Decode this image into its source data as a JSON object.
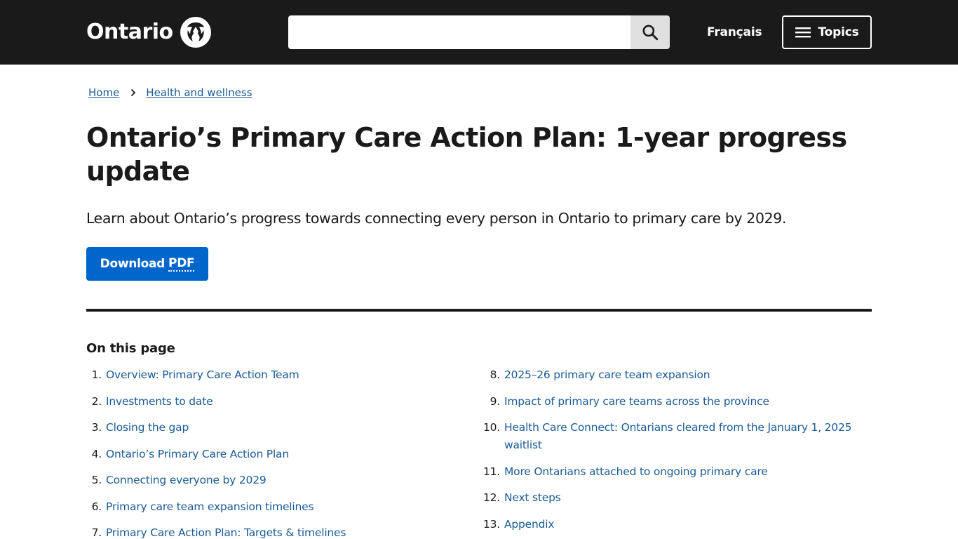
{
  "header": {
    "logo_text": "Ontario",
    "logo_icon": "ontario-trillium-icon",
    "search_placeholder": "",
    "search_icon": "search-icon",
    "language_link": "Français",
    "topics_label": "Topics",
    "topics_icon": "menu-icon"
  },
  "breadcrumb": {
    "items": [
      {
        "label": "Home"
      },
      {
        "label": "Health and wellness"
      }
    ],
    "separator_icon": "chevron-right-icon"
  },
  "page": {
    "title": "Ontario’s Primary Care Action Plan: 1-year progress update",
    "lead": "Learn about Ontario’s progress towards connecting every person in Ontario to primary care by 2029.",
    "download_label": "Download",
    "download_abbr": "PDF"
  },
  "on_this_page": {
    "heading": "On this page",
    "items": [
      {
        "num": "1.",
        "label": "Overview: Primary Care Action Team"
      },
      {
        "num": "2.",
        "label": "Investments to date"
      },
      {
        "num": "3.",
        "label": "Closing the gap"
      },
      {
        "num": "4.",
        "label": "Ontario’s Primary Care Action Plan"
      },
      {
        "num": "5.",
        "label": "Connecting everyone by 2029"
      },
      {
        "num": "6.",
        "label": "Primary care team expansion timelines"
      },
      {
        "num": "7.",
        "label": "Primary Care Action Plan: Targets & timelines"
      },
      {
        "num": "8.",
        "label": "2025–26 primary care team expansion"
      },
      {
        "num": "9.",
        "label": "Impact of primary care teams across the province"
      },
      {
        "num": "10.",
        "label": "Health Care Connect: Ontarians cleared from the January 1, 2025 waitlist"
      },
      {
        "num": "11.",
        "label": "More Ontarians attached to ongoing primary care"
      },
      {
        "num": "12.",
        "label": "Next steps"
      },
      {
        "num": "13.",
        "label": "Appendix"
      }
    ]
  },
  "colors": {
    "header_bg": "#1a1a1a",
    "link": "#1a5a96",
    "primary_button": "#0066cc"
  }
}
